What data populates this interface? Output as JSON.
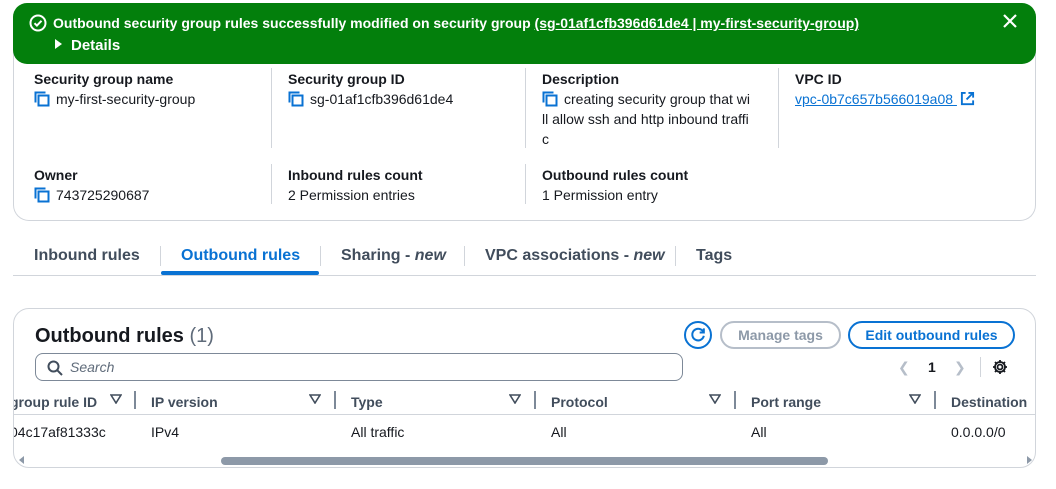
{
  "flash": {
    "message": "Outbound security group rules successfully modified on security group ",
    "link_text": "(sg-01af1cfb396d61de4 | my-first-security-group)",
    "details_label": "Details",
    "color": "#037f0c"
  },
  "details": {
    "sg_name_label": "Security group name",
    "sg_name_value": "my-first-security-group",
    "sg_id_label": "Security group ID",
    "sg_id_value": "sg-01af1cfb396d61de4",
    "description_label": "Description",
    "description_line1": "creating security group that wi",
    "description_line2": "ll allow ssh and http inbound traffi",
    "description_line3": "c",
    "vpc_id_label": "VPC ID",
    "vpc_id_value": "vpc-0b7c657b566019a08",
    "owner_label": "Owner",
    "owner_value": "743725290687",
    "inbound_count_label": "Inbound rules count",
    "inbound_count_value": "2 Permission entries",
    "outbound_count_label": "Outbound rules count",
    "outbound_count_value": "1 Permission entry"
  },
  "tabs": {
    "inbound": "Inbound rules",
    "outbound": "Outbound rules",
    "sharing": "Sharing - ",
    "sharing_new": "new",
    "vpc_assoc": "VPC associations - ",
    "vpc_assoc_new": "new",
    "tags": "Tags",
    "active": "outbound"
  },
  "outbound_panel": {
    "title": "Outbound rules",
    "count": "(1)",
    "manage_tags": "Manage tags",
    "edit_button": "Edit outbound rules",
    "search_placeholder": "Search",
    "page_number": "1",
    "prev": "❮",
    "next": "❯",
    "columns": [
      "group rule ID",
      "IP version",
      "Type",
      "Protocol",
      "Port range",
      "Destination"
    ],
    "rows": [
      [
        "04c17af81333c",
        "IPv4",
        "All traffic",
        "All",
        "All",
        "0.0.0.0/0"
      ]
    ]
  },
  "colors": {
    "accent": "#0972d3",
    "success": "#037f0c",
    "border": "#d1d5db"
  }
}
